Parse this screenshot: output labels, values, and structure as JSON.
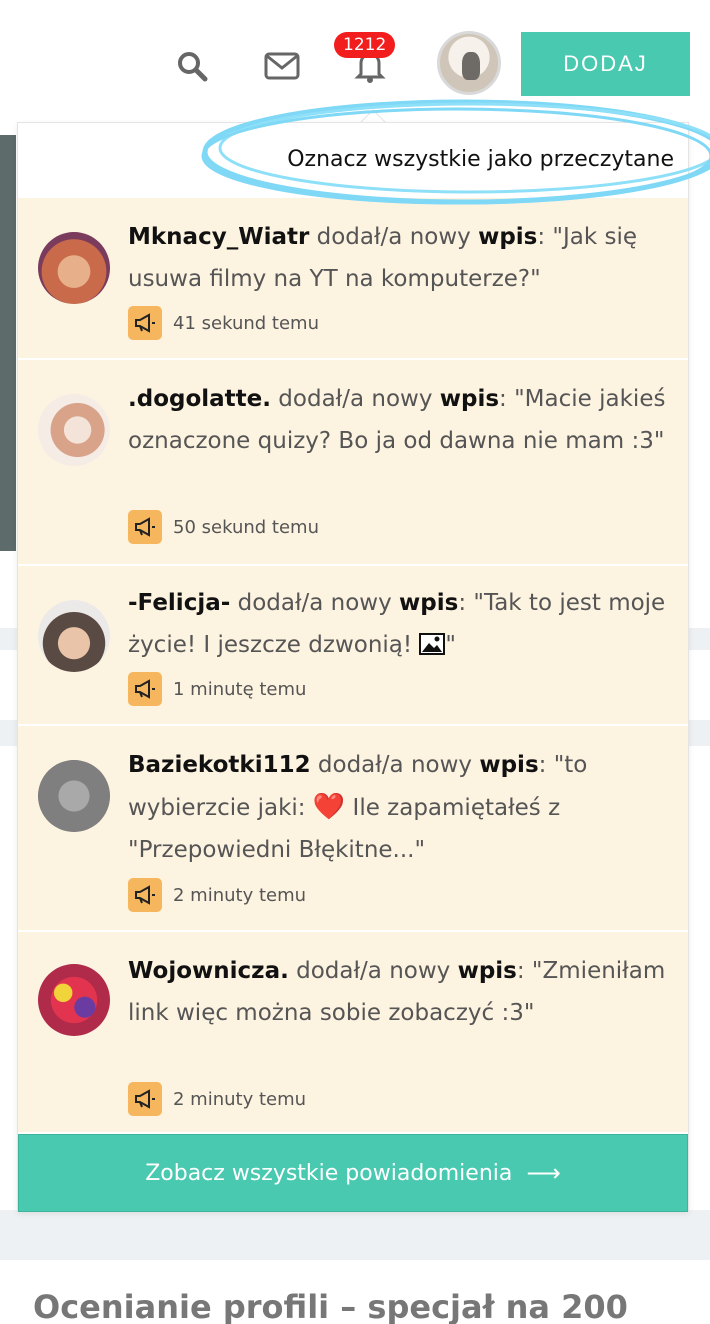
{
  "header": {
    "notification_count": "1212",
    "add_button_label": "DODAJ"
  },
  "dropdown": {
    "mark_all_read": "Oznacz wszystkie jako przeczytane",
    "see_all_label": "Zobacz wszystkie powiadomienia",
    "notifications": [
      {
        "user": "Mknacy_Wiatr",
        "action": " dodał/a nowy ",
        "type": "wpis",
        "content": ": \"Jak się usuwa filmy na YT na komputerze?\"",
        "time": "41 sekund temu",
        "avatar_color": "#c96a4a"
      },
      {
        "user": ".dogolatte.",
        "action": " dodał/a nowy ",
        "type": "wpis",
        "content": ": \"Macie jakieś oznaczone quizy? Bo ja od dawna nie mam :3\"",
        "time": "50 sekund temu",
        "avatar_color": "#d9a38a"
      },
      {
        "user": "-Felicja-",
        "action": " dodał/a nowy ",
        "type": "wpis",
        "content": ": \"Tak to jest moje życie! I jeszcze dzwonią! ",
        "content_end": "\"",
        "time": "1 minutę temu",
        "avatar_color": "#8a7a72"
      },
      {
        "user": "Baziekotki112",
        "action": " dodał/a nowy ",
        "type": "wpis",
        "content_start": ": \"to wybierzcie jaki: ",
        "heart": "❤️",
        "content": " Ile zapamiętałeś z \"Przepowiedni Błękitne...\"",
        "time": "2 minuty temu",
        "avatar_color": "#8b8b8b"
      },
      {
        "user": "Wojownicza.",
        "action": " dodał/a nowy ",
        "type": "wpis",
        "content": ": \"Zmieniłam link więc można sobie zobaczyć :3\"",
        "time": "2 minuty temu",
        "avatar_color": "#c8304a"
      }
    ]
  },
  "background": {
    "card_title": "Ocenianie profili – specjał na 200"
  },
  "colors": {
    "accent": "#48c9b0",
    "notification_bg": "#fdf3e1",
    "badge": "#f21d1d",
    "megaphone": "#f6b65e",
    "highlight_circle": "#7fd8f5"
  }
}
